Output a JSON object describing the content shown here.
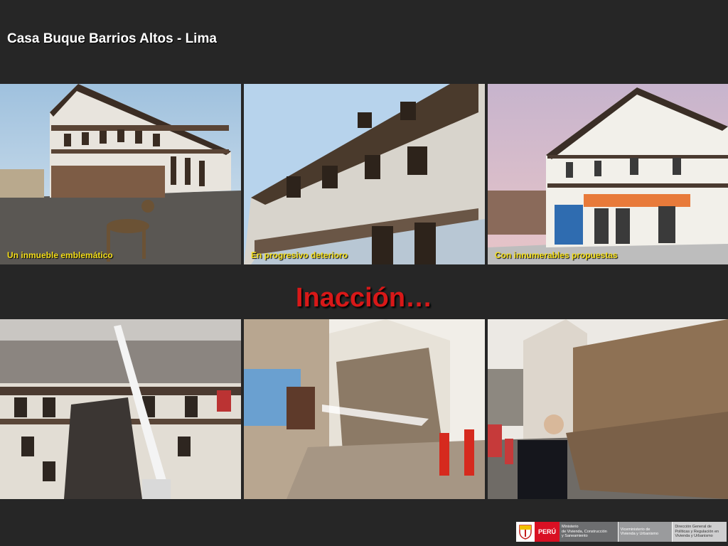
{
  "slide": {
    "title": "Casa Buque Barrios Altos - Lima",
    "heading": "Inacción…"
  },
  "photos_top": [
    {
      "caption": "Un inmueble emblemático"
    },
    {
      "caption": "En progresivo deterioro"
    },
    {
      "caption": "Con innumerables propuestas"
    }
  ],
  "footer": {
    "country": "PERÚ",
    "ministry": "Ministerio\nde Vivienda, Construcción\ny Saneamiento",
    "vice_ministry": "Viceministerio de\nVivienda y Urbanismo",
    "directorate": "Dirección General de\nPolíticas y Regulación en\nVivienda y Urbanismo"
  },
  "colors": {
    "background": "#262626",
    "heading": "#d81818",
    "caption": "#f5df1a",
    "peru_red": "#d91023"
  }
}
